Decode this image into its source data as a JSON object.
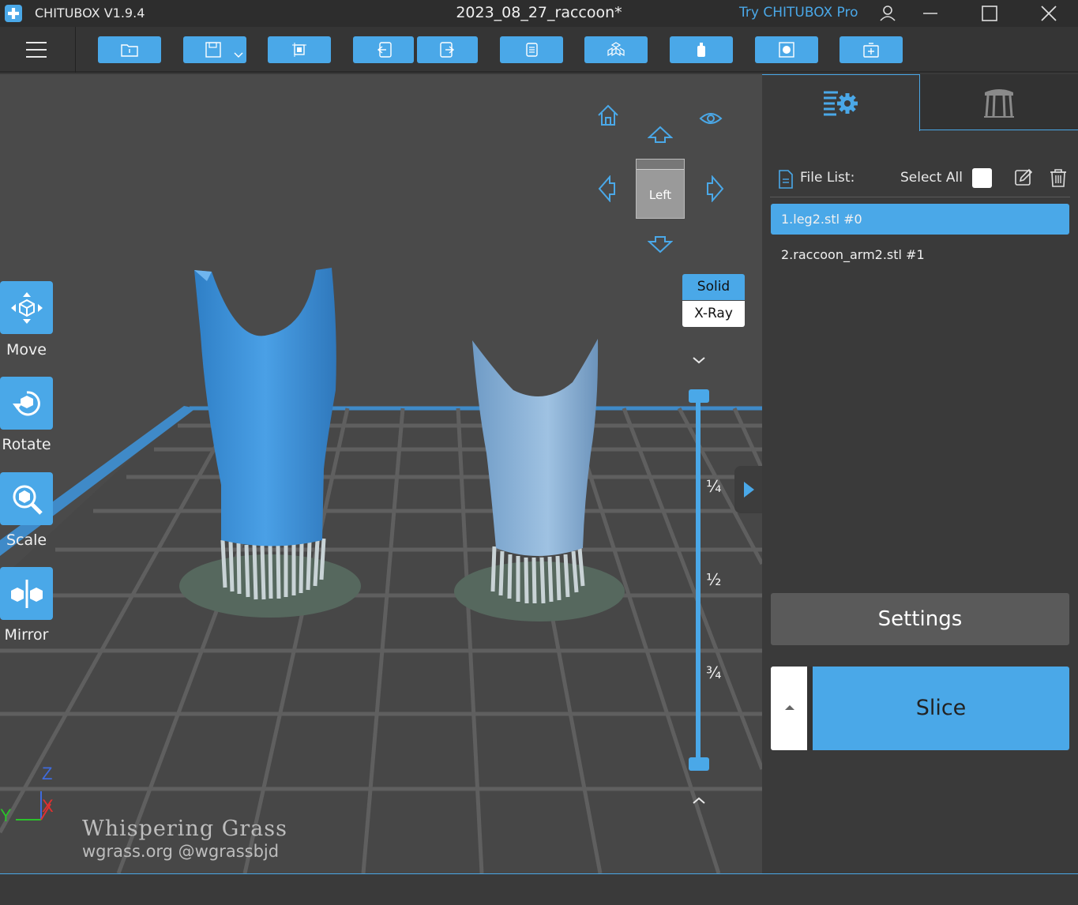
{
  "titlebar": {
    "app_name": "CHITUBOX V1.9.4",
    "document": "2023_08_27_raccoon*",
    "try_pro": "Try CHITUBOX Pro"
  },
  "toolbar": {
    "buttons": [
      "open-file-icon",
      "save-icon",
      "auto-layout-icon",
      "undo-icon",
      "redo-icon",
      "copy-icon",
      "arrange-icon",
      "hollow-icon",
      "holes-icon",
      "add-support-icon"
    ]
  },
  "tools": [
    {
      "label": "Move",
      "icon": "move-icon"
    },
    {
      "label": "Rotate",
      "icon": "rotate-icon"
    },
    {
      "label": "Scale",
      "icon": "scale-icon"
    },
    {
      "label": "Mirror",
      "icon": "mirror-icon"
    }
  ],
  "view": {
    "cube_face": "Left",
    "mode_solid": "Solid",
    "mode_xray": "X-Ray",
    "fraction_quarter": "¼",
    "fraction_half": "½",
    "fraction_three_quarter": "¾",
    "slider_range": [
      0,
      1
    ]
  },
  "axes": {
    "z": "Z",
    "y": "Y",
    "x": "X"
  },
  "watermark": {
    "title": "Whispering Grass",
    "subtitle": "wgrass.org @wgrassbjd"
  },
  "panel": {
    "file_list_label": "File List:",
    "select_all_label": "Select All",
    "files": [
      {
        "name": "1.leg2.stl #0",
        "selected": true
      },
      {
        "name": "2.raccoon_arm2.stl #1",
        "selected": false
      }
    ],
    "settings_label": "Settings",
    "slice_label": "Slice"
  },
  "colors": {
    "accent": "#4aa8e8",
    "model_selected": "#3a8fd6",
    "model_unselected": "#7fa8cf"
  }
}
